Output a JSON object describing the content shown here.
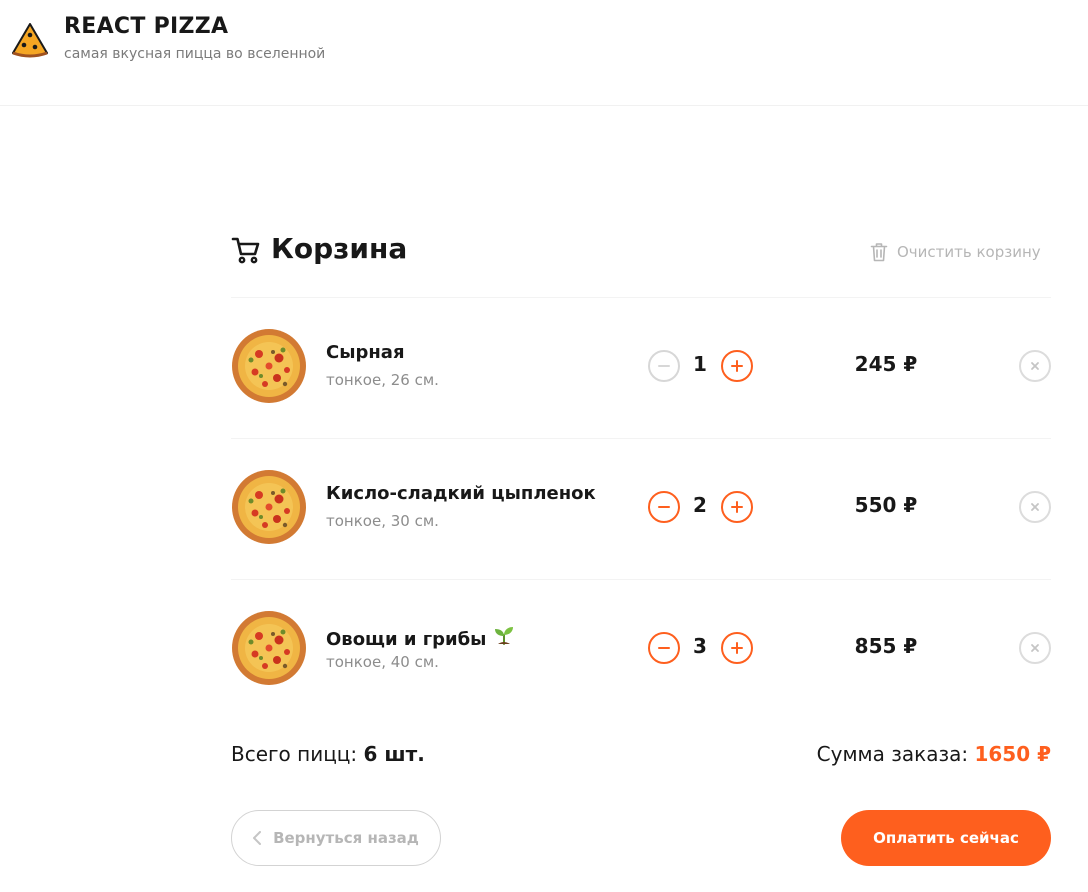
{
  "header": {
    "title": "REACT PIZZA",
    "subtitle": "самая вкусная пицца во вселенной",
    "logo_icon": "pizza-slice-icon"
  },
  "cart": {
    "title": "Корзина",
    "title_icon": "shopping-cart-icon",
    "clear_label": "Очистить корзину",
    "clear_icon": "trash-icon",
    "items": [
      {
        "name": "Сырная",
        "desc": "тонкое, 26 см.",
        "qty": "1",
        "price": "245 ₽",
        "minus_disabled": true,
        "veg": false
      },
      {
        "name": "Кисло-сладкий цыпленок",
        "desc": "тонкое, 30 см.",
        "qty": "2",
        "price": "550 ₽",
        "minus_disabled": false,
        "veg": false
      },
      {
        "name": "Овощи и грибы",
        "desc": "тонкое, 40 см.",
        "qty": "3",
        "price": "855 ₽",
        "minus_disabled": false,
        "veg": true,
        "veg_icon": "sprout-icon"
      }
    ],
    "total_count_label": "Всего пицц:",
    "total_count_value": "6 шт.",
    "total_sum_label": "Сумма заказа:",
    "total_sum_value": "1650 ₽",
    "back_label": "Вернуться назад",
    "pay_label": "Оплатить сейчас"
  },
  "colors": {
    "accent": "#fe5f1e",
    "text": "#181818",
    "muted": "#8d8d8d",
    "disabled_border": "#d7d7d7"
  }
}
